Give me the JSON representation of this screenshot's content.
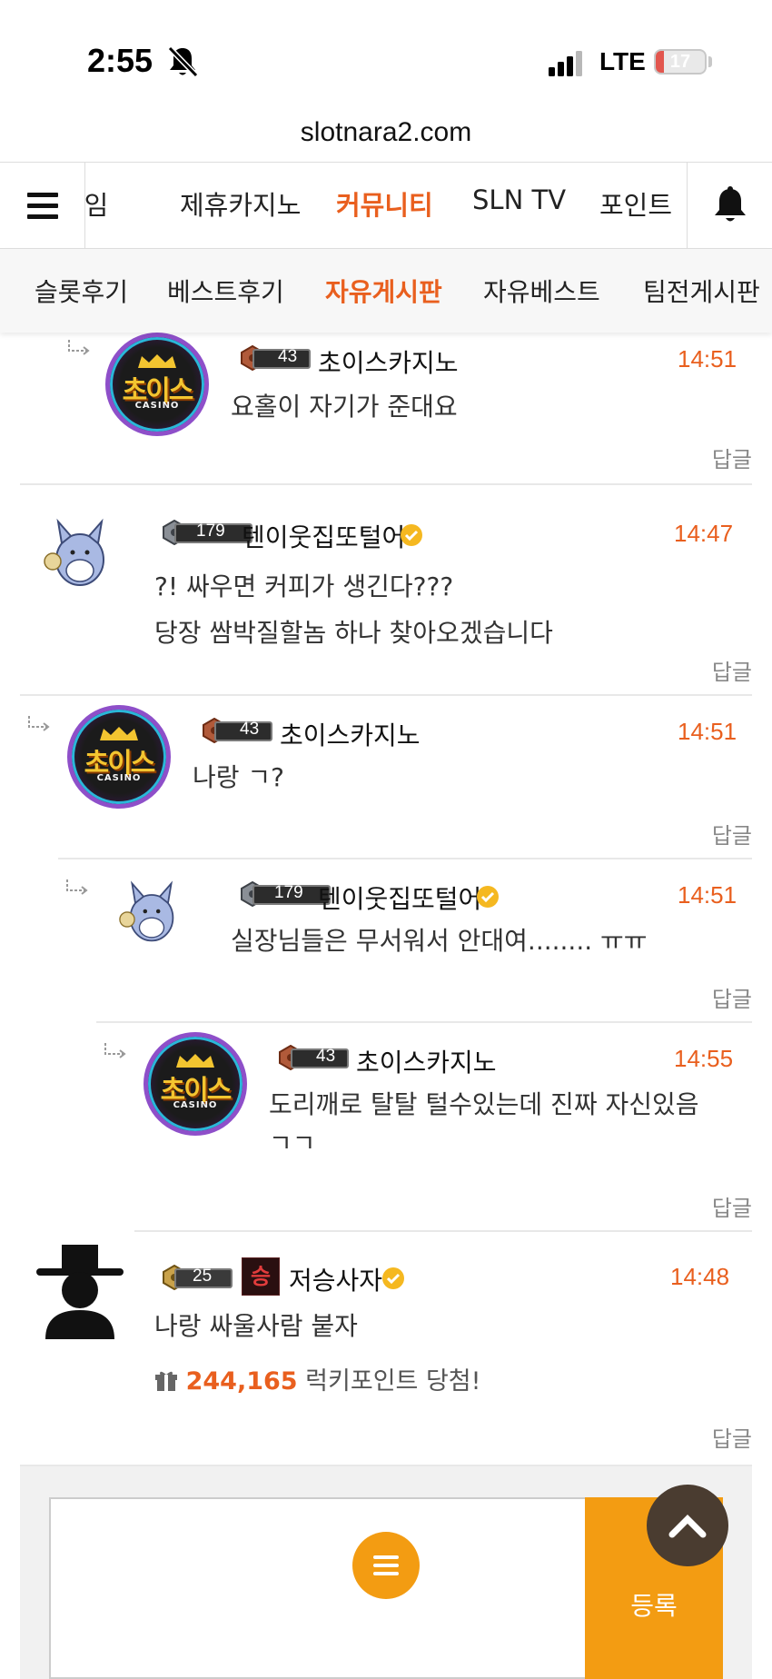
{
  "status_bar": {
    "time": "2:55",
    "network": "LTE",
    "battery": "17",
    "battery_level": 0.17,
    "icons": [
      "bell-slash-icon",
      "signal-icon"
    ]
  },
  "browser": {
    "url": "slotnara2.com"
  },
  "main_nav": {
    "items": [
      {
        "label": "게임",
        "active": false
      },
      {
        "label": "제휴카지노",
        "active": false
      },
      {
        "label": "커뮤니티",
        "active": true
      },
      {
        "label": "SLN TV",
        "active": false
      },
      {
        "label": "포인트",
        "active": false
      }
    ],
    "icons": [
      "hamburger-menu-icon",
      "bell-icon"
    ]
  },
  "sub_nav": {
    "items": [
      {
        "label": "슬롯후기",
        "active": false
      },
      {
        "label": "베스트후기",
        "active": false
      },
      {
        "label": "자유게시판",
        "active": true
      },
      {
        "label": "자유베스트",
        "active": false
      },
      {
        "label": "팀전게시판",
        "active": false
      }
    ]
  },
  "comments": [
    {
      "username": "초이스카지노",
      "level": "43",
      "time": "14:51",
      "lines": [
        "요홀이 자기가 준대요"
      ],
      "reply_label": "답글",
      "avatar_text": "초이스",
      "avatar_sub": "CASINO",
      "is_reply": true
    },
    {
      "username": "텐이웃집또털어",
      "level": "179",
      "time": "14:47",
      "lines": [
        "?! 싸우면 커피가 생긴다???",
        "당장 쌈박질할놈 하나 찾아오겠습니다"
      ],
      "reply_label": "답글",
      "verified": true,
      "is_reply": false
    },
    {
      "username": "초이스카지노",
      "level": "43",
      "time": "14:51",
      "lines": [
        "나랑 ㄱ?"
      ],
      "reply_label": "답글",
      "avatar_text": "초이스",
      "avatar_sub": "CASINO",
      "is_reply": true
    },
    {
      "username": "텐이웃집또털어",
      "level": "179",
      "time": "14:51",
      "lines": [
        "실장님들은 무서워서 안대여........ ㅠㅠ"
      ],
      "reply_label": "답글",
      "verified": true,
      "is_reply": true
    },
    {
      "username": "초이스카지노",
      "level": "43",
      "time": "14:55",
      "lines": [
        "도리깨로 탈탈 털수있는데 진짜 자신있음",
        "ㄱㄱ"
      ],
      "reply_label": "답글",
      "avatar_text": "초이스",
      "avatar_sub": "CASINO",
      "is_reply": true
    },
    {
      "username": "저승사자",
      "level": "25",
      "rank_badge": "승",
      "time": "14:48",
      "lines": [
        "나랑 싸울사람 붙자"
      ],
      "lucky_amount": "244,165",
      "lucky_text": "럭키포인트 당첨!",
      "reply_label": "답글",
      "verified": true,
      "is_reply": false
    }
  ],
  "composer": {
    "submit_label": "등록",
    "icons": [
      "menu-icon",
      "scroll-to-top-icon"
    ]
  },
  "colors": {
    "accent": "#e95f1e",
    "button": "#f39c12",
    "avatar_ring": "#8e4fc9"
  }
}
